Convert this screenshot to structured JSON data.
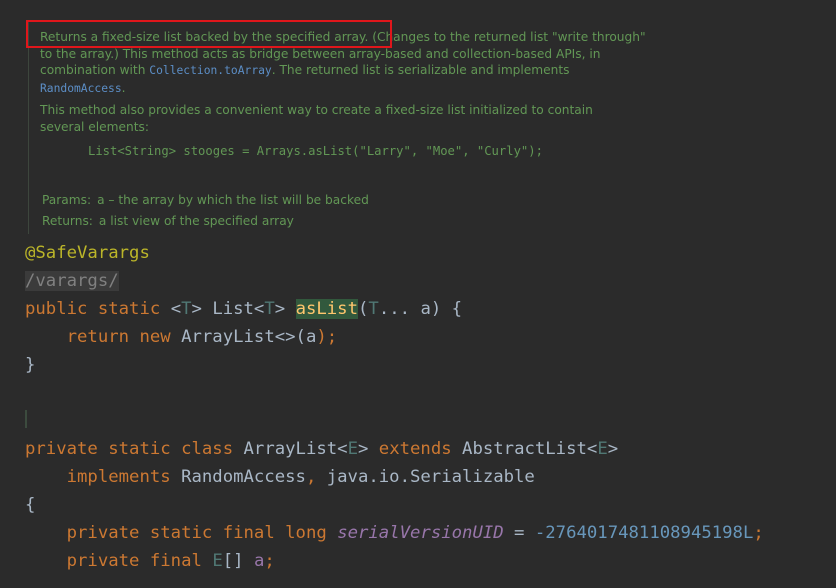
{
  "javadoc": {
    "p1_start": "Returns a fixed-size list backed by the specified array. (Changes to the returned list \"write through\" to the array.) This method acts as bridge between array-based and collection-based APIs, in combination with ",
    "p1_link1": "Collection.toArray",
    "p1_mid": ". The returned list is serializable and implements ",
    "p1_link2": "RandomAccess",
    "p1_end": ".",
    "p2": "This method also provides a convenient way to create a fixed-size list initialized to contain several elements:",
    "example_code": "List<String> stooges = Arrays.asList(\"Larry\", \"Moe\", \"Curly\");",
    "params_label": "Params:",
    "params_text": "a – the array by which the list will be backed",
    "returns_label": "Returns:",
    "returns_text": "a list view of the specified array"
  },
  "code": {
    "annotation": "@SafeVarargs",
    "comment": "/varargs/",
    "l3": {
      "public": "public",
      "static": "static",
      "lt": "<",
      "T": "T",
      "gt": "> ",
      "List": "List<",
      "T2": "T",
      "gt2": "> ",
      "name": "asList",
      "open": "(",
      "T3": "T",
      "dots": "... ",
      "a": "a",
      "close": ") {"
    },
    "l4": {
      "indent": "    ",
      "return": "return",
      "new": "new",
      "rest": "ArrayList<>(",
      "a": "a",
      "end": ");"
    },
    "l5": "}",
    "l6": {
      "private": "private",
      "static": "static",
      "class": "class",
      "name": "ArrayList<",
      "E": "E",
      "gt": "> ",
      "extends": "extends",
      "base": "AbstractList<",
      "E2": "E",
      "end": ">"
    },
    "l7": {
      "indent": "    ",
      "implements": "implements",
      "ra": "RandomAccess",
      "comma": ", ",
      "ser": "java.io.Serializable"
    },
    "l8": "{",
    "l9": {
      "indent": "    ",
      "private": "private",
      "static": "static",
      "final": "final",
      "long": "long",
      "field": "serialVersionUID",
      "eq": " = ",
      "minus": "-",
      "num": "2764017481108945198L",
      "semi": ";"
    },
    "l10": {
      "indent": "    ",
      "private": "private",
      "final": "final",
      "E": "E",
      "arr": "[] ",
      "a": "a",
      "semi": ";"
    }
  }
}
